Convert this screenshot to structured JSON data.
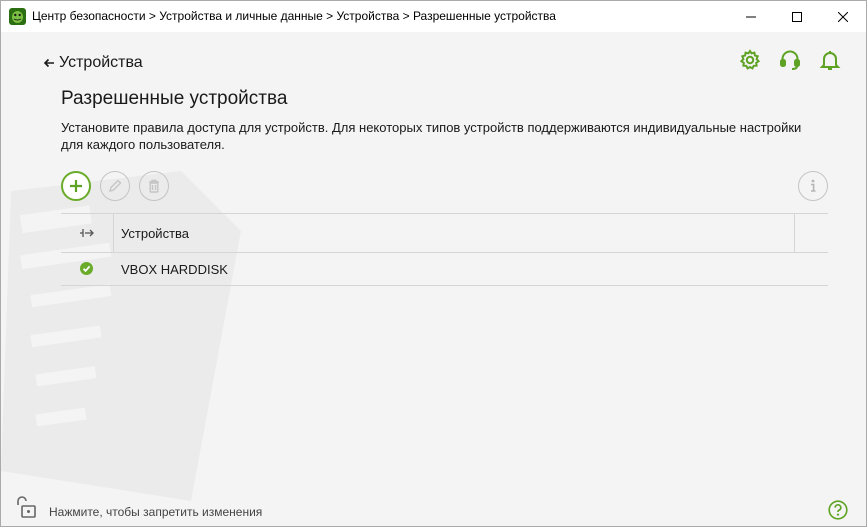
{
  "window": {
    "title": "Центр безопасности > Устройства и личные данные > Устройства > Разрешенные устройства"
  },
  "header": {
    "back_label": "Устройства"
  },
  "page": {
    "title": "Разрешенные устройства",
    "description": "Установите правила доступа для устройств. Для некоторых типов устройств поддерживаются индивидуальные настройки для каждого пользователя."
  },
  "table": {
    "column_header": "Устройства",
    "rows": [
      {
        "name": "VBOX HARDDISK",
        "status": "allowed"
      }
    ]
  },
  "footer": {
    "lock_text": "Нажмите, чтобы запретить изменения"
  },
  "colors": {
    "accent": "#6aab2a",
    "status_allowed": "#6aab2a"
  },
  "icons": {
    "app": "drweb-spider-icon",
    "back": "arrow-left-icon",
    "settings": "gear-icon",
    "support": "headset-icon",
    "notifications": "bell-icon",
    "add": "plus-icon",
    "edit": "pencil-icon",
    "delete": "trash-icon",
    "info": "info-icon",
    "column": "plug-icon",
    "lock": "unlock-icon",
    "help": "question-icon"
  }
}
